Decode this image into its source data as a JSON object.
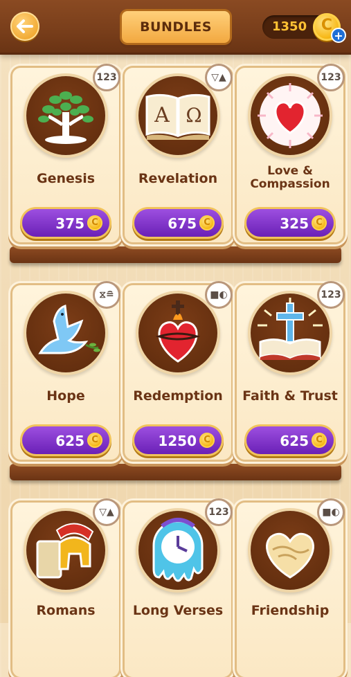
{
  "header": {
    "title": "BUNDLES",
    "coins": "1350",
    "coin_symbol": "C",
    "plus": "+"
  },
  "bundles": [
    {
      "name": "Genesis",
      "price": "375",
      "badge": "123",
      "icon": "tree-icon"
    },
    {
      "name": "Revelation",
      "price": "675",
      "badge": "▽▲",
      "icon": "alpha-omega-book-icon"
    },
    {
      "name": "Love & Compassion",
      "price": "325",
      "badge": "123",
      "icon": "heart-icon"
    },
    {
      "name": "Hope",
      "price": "625",
      "badge": "⧖≘",
      "icon": "dove-icon"
    },
    {
      "name": "Redemption",
      "price": "1250",
      "badge": "■◐",
      "icon": "sacred-heart-icon"
    },
    {
      "name": "Faith & Trust",
      "price": "625",
      "badge": "123",
      "icon": "cross-bible-icon"
    },
    {
      "name": "Romans",
      "price": "",
      "badge": "▽▲",
      "icon": "roman-helmet-icon"
    },
    {
      "name": "Long Verses",
      "price": "",
      "badge": "123",
      "icon": "melting-clock-icon"
    },
    {
      "name": "Friendship",
      "price": "",
      "badge": "■◐",
      "icon": "handshake-heart-icon"
    }
  ],
  "colors": {
    "wood": "#7a3f1b",
    "price_button": "#7a2fc8",
    "coin": "#f7b918",
    "title_text": "#6a3415"
  }
}
